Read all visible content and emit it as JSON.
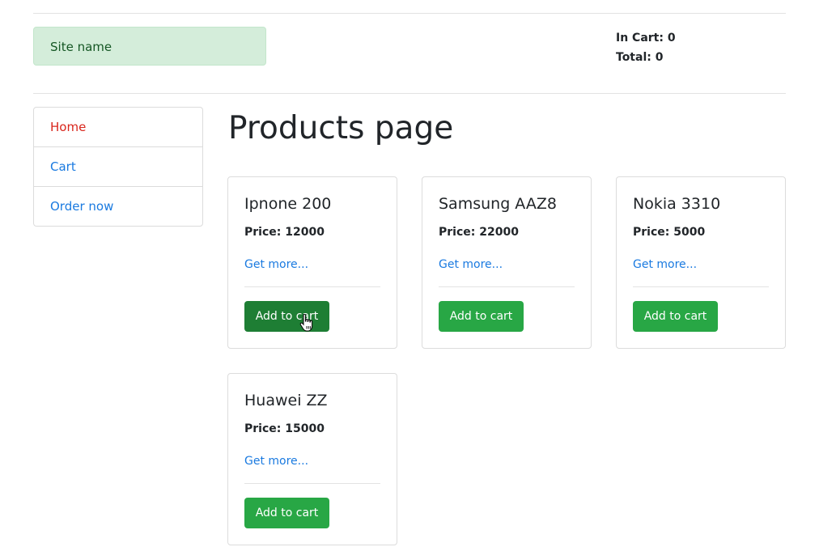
{
  "header": {
    "site_name": "Site name",
    "in_cart": "In Cart: 0",
    "total": "Total: 0"
  },
  "sidebar": {
    "items": [
      {
        "label": "Home",
        "active": true
      },
      {
        "label": "Cart",
        "active": false
      },
      {
        "label": "Order now",
        "active": false
      }
    ]
  },
  "main": {
    "title": "Products page",
    "products": [
      {
        "name": "Ipnone 200",
        "price": "Price: 12000",
        "link": "Get more...",
        "button": "Add to cart"
      },
      {
        "name": "Samsung AAZ8",
        "price": "Price: 22000",
        "link": "Get more...",
        "button": "Add to cart"
      },
      {
        "name": "Nokia 3310",
        "price": "Price: 5000",
        "link": "Get more...",
        "button": "Add to cart"
      },
      {
        "name": "Huawei ZZ",
        "price": "Price: 15000",
        "link": "Get more...",
        "button": "Add to cart"
      }
    ]
  },
  "colors": {
    "accent_green": "#28a745",
    "button_hover": "#1e7e34",
    "link_blue": "#1a7ae0",
    "active_red": "#d9261c",
    "site_name_bg": "#d4edda"
  },
  "icons": {
    "cursor": "hand-pointer-icon"
  }
}
